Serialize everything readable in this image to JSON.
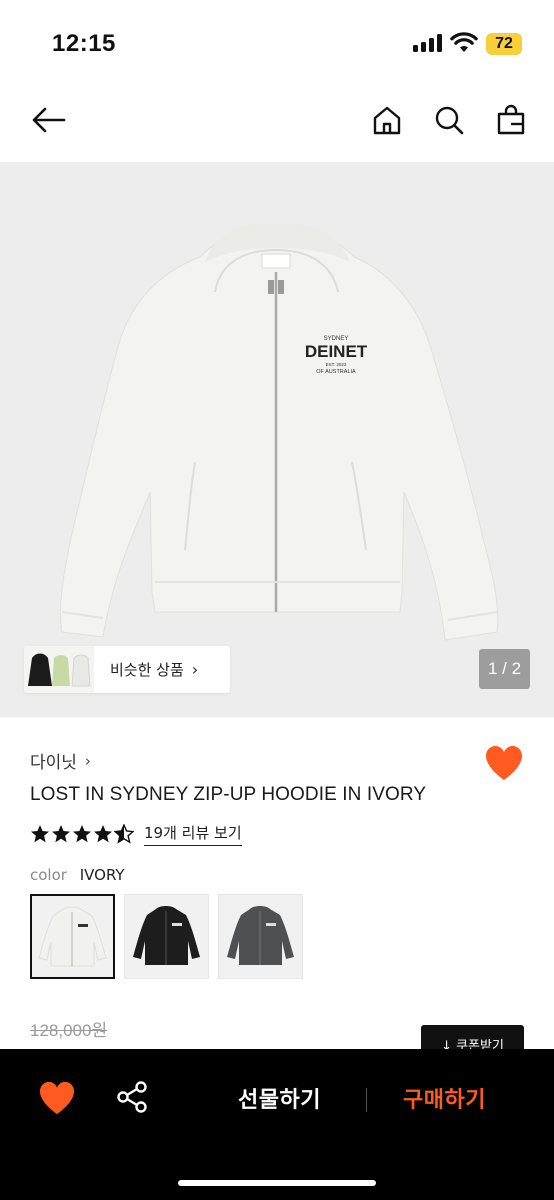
{
  "status_bar": {
    "time": "12:15",
    "battery": "72",
    "battery_color": "#f7cf3b"
  },
  "nav": {
    "icons": [
      "back-arrow-icon",
      "home-icon",
      "search-icon",
      "shopping-bag-icon"
    ]
  },
  "gallery": {
    "similar_label": "비슷한 상품",
    "page_indicator": "1 / 2",
    "current_page": 1,
    "total_pages": 2,
    "print": {
      "top": "SYDNEY",
      "brand": "DEINET",
      "middle": "EST. 2023",
      "bottom": "OF AUSTRALIA"
    }
  },
  "product": {
    "brand": "다이닛",
    "title": "LOST IN SYDNEY ZIP-UP HOODIE IN IVORY",
    "rating": 4.5,
    "review_link": "19개 리뷰 보기",
    "color_label": "color",
    "color_value": "IVORY",
    "swatches": [
      "ivory",
      "black",
      "charcoal"
    ],
    "price_original": "128,000원",
    "coupon_label": "↓ 쿠폰받기"
  },
  "bottom_bar": {
    "gift_label": "선물하기",
    "buy_label": "구매하기",
    "accent_color": "#ff5a1f"
  },
  "colors": {
    "heart": "#ff5a1f",
    "background": "#ffffff",
    "image_bg": "#ededed"
  }
}
